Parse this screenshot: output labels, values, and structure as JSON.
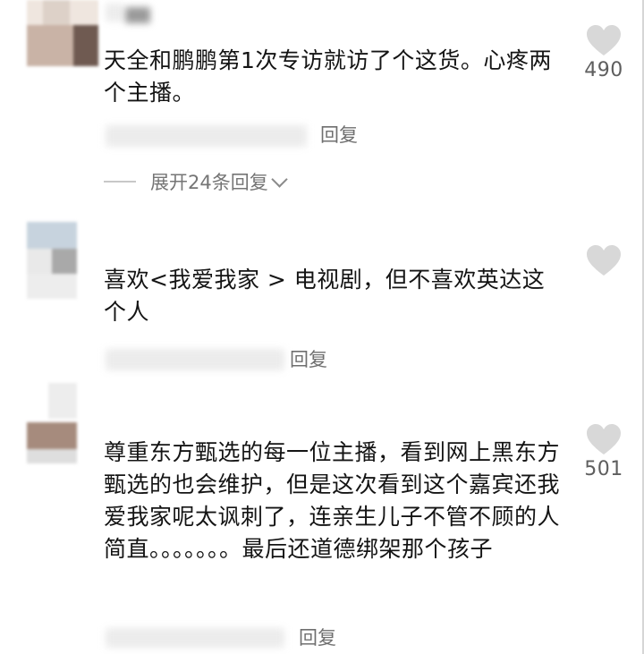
{
  "comments": [
    {
      "text": "天全和鹏鹏第1次专访就访了个这货。心疼两个主播。",
      "reply_label": "回复",
      "like_count": "490",
      "expand_label": "展开24条回复"
    },
    {
      "text": "喜欢<我爱我家 > 电视剧，但不喜欢英达这个人",
      "reply_label": "回复",
      "like_count": ""
    },
    {
      "text": "尊重东方甄选的每一位主播，看到网上黑东方甄选的也会维护，但是这次看到这个嘉宾还我爱我家呢太讽刺了，连亲生儿子不管不顾的人简直。。。。。。。最后还道德绑架那个孩子",
      "reply_label": "回复",
      "like_count": "501"
    }
  ],
  "icons": {
    "like": "heart-icon",
    "expand": "chevron-down-icon"
  },
  "colors": {
    "text": "#141414",
    "muted": "#757575",
    "heart": "#d8d8d8",
    "background": "#ffffff"
  }
}
